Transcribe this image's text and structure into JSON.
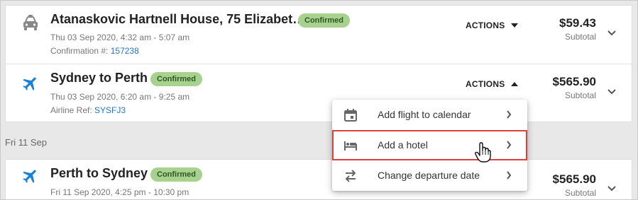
{
  "segments": [
    {
      "icon": "car-icon",
      "title": "Atanaskovic Hartnell House, 75 Elizabet…",
      "status": "Confirmed",
      "time": "Thu 03 Sep 2020, 4:32 am - 5:07 am",
      "ref_label": "Confirmation #:",
      "ref_value": "157238",
      "actions_label": "ACTIONS",
      "price": "$59.43",
      "price_label": "Subtotal"
    },
    {
      "icon": "airplane-icon",
      "title": "Sydney to Perth",
      "status": "Confirmed",
      "time": "Thu 03 Sep 2020, 6:20 am - 9:25 am",
      "ref_label": "Airline Ref:",
      "ref_value": "SYSFJ3",
      "actions_label": "ACTIONS",
      "price": "$565.90",
      "price_label": "Subtotal"
    },
    {
      "icon": "airplane-icon",
      "title": "Perth to Sydney",
      "status": "Confirmed",
      "time": "Fri 11 Sep 2020, 4:25 pm - 10:30 pm",
      "price": "$565.90",
      "price_label": "Subtotal"
    }
  ],
  "date_group": "Fri 11 Sep",
  "actions_menu": {
    "items": [
      {
        "label": "Add flight to calendar",
        "icon": "calendar-icon"
      },
      {
        "label": "Add a hotel",
        "icon": "bed-icon",
        "highlighted": true
      },
      {
        "label": "Change departure date",
        "icon": "swap-arrows-icon"
      }
    ]
  },
  "colors": {
    "badge_bg": "#a6d18f",
    "link": "#1f74c9",
    "plane": "#1a82d6",
    "highlight_border": "#e0403b"
  }
}
